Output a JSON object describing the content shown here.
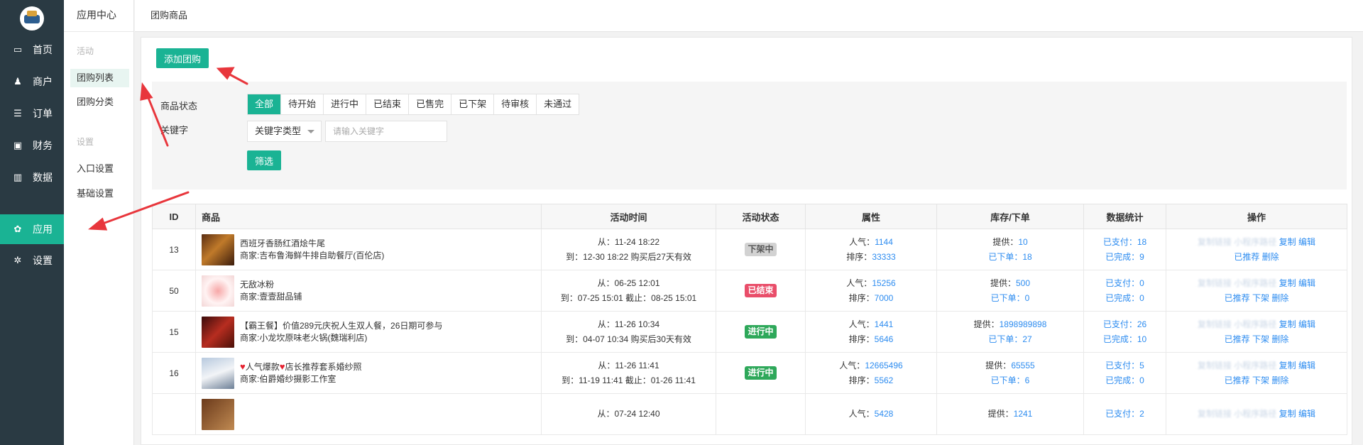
{
  "nav": [
    {
      "label": "首页",
      "icon": "monitor-icon",
      "glyph": "▭"
    },
    {
      "label": "商户",
      "icon": "users-icon",
      "glyph": "♟"
    },
    {
      "label": "订单",
      "icon": "list-icon",
      "glyph": "☰"
    },
    {
      "label": "财务",
      "icon": "money-icon",
      "glyph": "▣"
    },
    {
      "label": "数据",
      "icon": "bar-chart-icon",
      "glyph": "▥"
    },
    {
      "label": "应用",
      "icon": "apps-icon",
      "glyph": "✿"
    },
    {
      "label": "设置",
      "icon": "gear-icon",
      "glyph": "✲"
    }
  ],
  "sub": {
    "title": "应用中心",
    "group_activity": "活动",
    "items_activity": [
      "团购列表",
      "团购分类"
    ],
    "group_settings": "设置",
    "items_settings": [
      "入口设置",
      "基础设置"
    ]
  },
  "breadcrumb": "团购商品",
  "add_button": "添加团购",
  "filter": {
    "status_label": "商品状态",
    "status_tabs": [
      "全部",
      "待开始",
      "进行中",
      "已结束",
      "已售完",
      "已下架",
      "待审核",
      "未通过"
    ],
    "keyword_label": "关键字",
    "keyword_type": "关键字类型",
    "keyword_placeholder": "请输入关键字",
    "submit": "筛选"
  },
  "columns": [
    "ID",
    "商品",
    "活动时间",
    "活动状态",
    "属性",
    "库存/下单",
    "数据统计",
    "操作"
  ],
  "rows": [
    {
      "id": "13",
      "name": "西班牙香肠红酒烩牛尾",
      "merchant": "商家:吉布鲁海鲜牛排自助餐厅(百伦店)",
      "time1": "从：11-24 18:22",
      "time2": "到：12-30 18:22 购买后27天有效",
      "status": "下架中",
      "status_color": "gray",
      "pop_label": "人气：",
      "pop": "1144",
      "sort_label": "排序：",
      "sort": "33333",
      "supply_label": "提供：",
      "supply": "10",
      "ordered_label": "已下单：",
      "ordered": "18",
      "paid_label": "已支付：",
      "paid": "18",
      "done_label": "已完成：",
      "done": "9",
      "op_blur": "复制链接  小程序路径",
      "op_copy": "复制",
      "op_edit": "编辑",
      "op_recommend": "已推荐",
      "op_offline": "",
      "op_delete": "删除"
    },
    {
      "id": "50",
      "name": "无敌冰粉",
      "merchant": "商家:壹壹甜品铺",
      "time1": "从：06-25 12:01",
      "time2": "到：07-25 15:01 截止：08-25 15:01",
      "status": "已结束",
      "status_color": "red",
      "pop_label": "人气：",
      "pop": "15256",
      "sort_label": "排序：",
      "sort": "7000",
      "supply_label": "提供：",
      "supply": "500",
      "ordered_label": "已下单：",
      "ordered": "0",
      "paid_label": "已支付：",
      "paid": "0",
      "done_label": "已完成：",
      "done": "0",
      "op_blur": "复制链接  小程序路径",
      "op_copy": "复制",
      "op_edit": "编辑",
      "op_recommend": "已推荐",
      "op_offline": "下架",
      "op_delete": "删除"
    },
    {
      "id": "15",
      "name": "【霸王餐】价值289元庆祝人生双人餐，26日期可参与",
      "merchant": "商家:小龙坎原味老火锅(魏瑞利店)",
      "time1": "从：11-26 10:34",
      "time2": "到：04-07 10:34 购买后30天有效",
      "status": "进行中",
      "status_color": "green",
      "pop_label": "人气：",
      "pop": "1441",
      "sort_label": "排序：",
      "sort": "5646",
      "supply_label": "提供：",
      "supply": "1898989898",
      "ordered_label": "已下单：",
      "ordered": "27",
      "paid_label": "已支付：",
      "paid": "26",
      "done_label": "已完成：",
      "done": "10",
      "op_blur": "复制链接  小程序路径",
      "op_copy": "复制",
      "op_edit": "编辑",
      "op_recommend": "已推荐",
      "op_offline": "下架",
      "op_delete": "删除"
    },
    {
      "id": "16",
      "name": "人气爆款",
      "name2": "店长推荐套系婚纱照",
      "merchant": "商家:伯爵婚纱摄影工作室",
      "time1": "从：11-26 11:41",
      "time2": "到：11-19 11:41 截止：01-26 11:41",
      "status": "进行中",
      "status_color": "green",
      "pop_label": "人气：",
      "pop": "12665496",
      "sort_label": "排序：",
      "sort": "5562",
      "supply_label": "提供：",
      "supply": "65555",
      "ordered_label": "已下单：",
      "ordered": "6",
      "paid_label": "已支付：",
      "paid": "5",
      "done_label": "已完成：",
      "done": "0",
      "op_blur": "复制链接  小程序路径",
      "op_copy": "复制",
      "op_edit": "编辑",
      "op_recommend": "已推荐",
      "op_offline": "下架",
      "op_delete": "删除"
    },
    {
      "id": "",
      "name": "",
      "merchant": "",
      "time1": "从：07-24 12:40",
      "time2": "",
      "status": "",
      "status_color": "",
      "pop_label": "人气：",
      "pop": "5428",
      "sort_label": "",
      "sort": "",
      "supply_label": "提供：",
      "supply": "1241",
      "ordered_label": "",
      "ordered": "",
      "paid_label": "已支付：",
      "paid": "2",
      "done_label": "",
      "done": "",
      "op_blur": "复制链接  小程序路径",
      "op_copy": "复制",
      "op_edit": "编辑",
      "op_recommend": "",
      "op_offline": "",
      "op_delete": ""
    }
  ],
  "colors": {
    "accent": "#1ab394",
    "nav_bg": "#2a3a43",
    "link": "#2d8cf0",
    "annotation_arrow": "#e8363c"
  }
}
